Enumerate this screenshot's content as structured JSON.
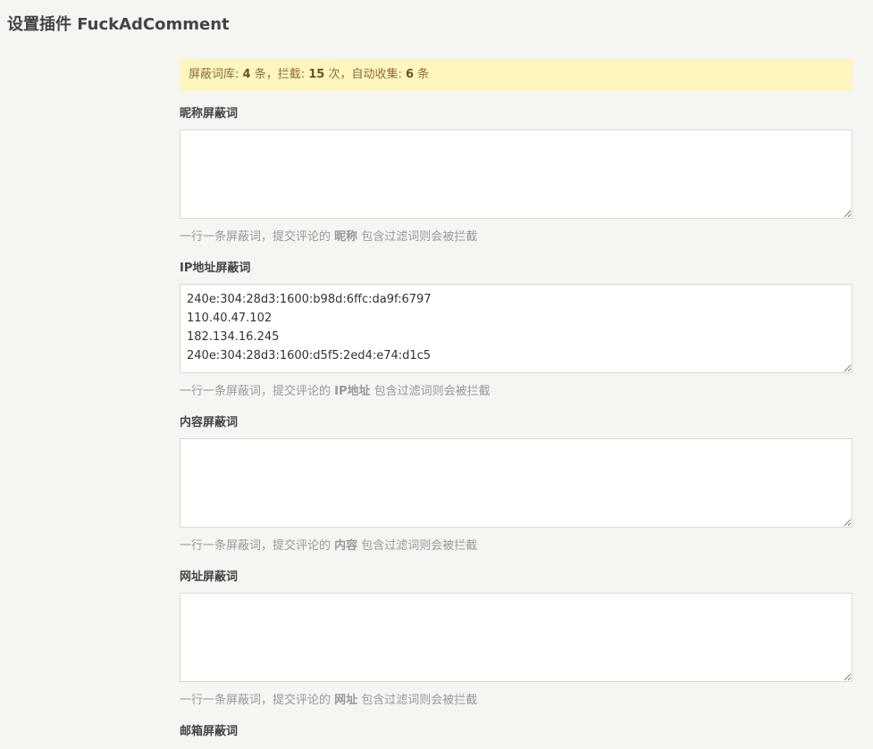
{
  "page": {
    "title": "设置插件 FuckAdComment"
  },
  "notice": {
    "prefix": "屏蔽词库: ",
    "lib_count": "4",
    "lib_unit": " 条，拦截: ",
    "block_count": "15",
    "block_unit": " 次，自动收集: ",
    "collect_count": "6",
    "collect_unit": " 条"
  },
  "fields": {
    "nickname": {
      "label": "昵称屏蔽词",
      "value": "",
      "desc_prefix": "一行一条屏蔽词，提交评论的 ",
      "desc_key": "昵称",
      "desc_suffix": " 包含过滤词则会被拦截"
    },
    "ip": {
      "label": "IP地址屏蔽词",
      "value": "240e:304:28d3:1600:b98d:6ffc:da9f:6797\n110.40.47.102\n182.134.16.245\n240e:304:28d3:1600:d5f5:2ed4:e74:d1c5",
      "desc_prefix": "一行一条屏蔽词，提交评论的 ",
      "desc_key": "IP地址",
      "desc_suffix": " 包含过滤词则会被拦截"
    },
    "content": {
      "label": "内容屏蔽词",
      "value": "",
      "desc_prefix": "一行一条屏蔽词，提交评论的 ",
      "desc_key": "内容",
      "desc_suffix": " 包含过滤词则会被拦截"
    },
    "url": {
      "label": "网址屏蔽词",
      "value": "",
      "desc_prefix": "一行一条屏蔽词，提交评论的 ",
      "desc_key": "网址",
      "desc_suffix": " 包含过滤词则会被拦截"
    },
    "email": {
      "label": "邮箱屏蔽词"
    }
  }
}
